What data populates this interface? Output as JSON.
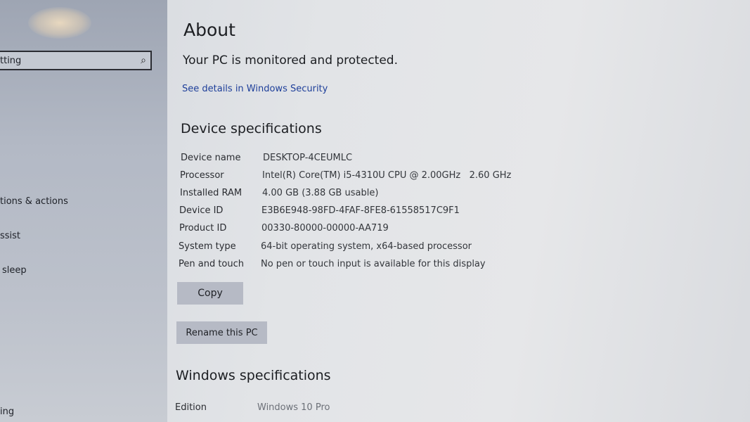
{
  "sidebar": {
    "search_value": "tting",
    "items": [
      "tions & actions",
      "ssist",
      "sleep",
      "ing"
    ]
  },
  "main": {
    "title": "About",
    "protection_status": "Your PC is monitored and protected.",
    "security_link": "See details in Windows Security",
    "device_specs_heading": "Device specifications",
    "device_specs": [
      {
        "label": "Device name",
        "value": "DESKTOP-4CEUMLC"
      },
      {
        "label": "Processor",
        "value": "Intel(R) Core(TM) i5-4310U CPU @ 2.00GHz   2.60 GHz"
      },
      {
        "label": "Installed RAM",
        "value": "4.00 GB (3.88 GB usable)"
      },
      {
        "label": "Device ID",
        "value": "E3B6E948-98FD-4FAF-8FE8-61558517C9F1"
      },
      {
        "label": "Product ID",
        "value": "00330-80000-00000-AA719"
      },
      {
        "label": "System type",
        "value": "64-bit operating system, x64-based processor"
      },
      {
        "label": "Pen and touch",
        "value": "No pen or touch input is available for this display"
      }
    ],
    "copy_label": "Copy",
    "rename_label": "Rename this PC",
    "windows_specs_heading": "Windows specifications",
    "windows_specs": [
      {
        "label": "Edition",
        "value": "Windows 10 Pro"
      }
    ]
  }
}
